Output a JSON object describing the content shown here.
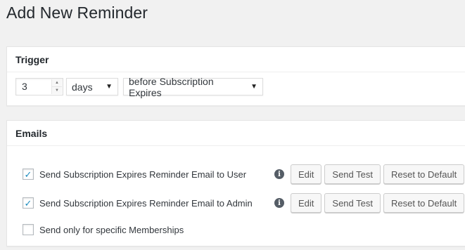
{
  "page": {
    "title": "Add New Reminder"
  },
  "trigger": {
    "heading": "Trigger",
    "amount": "3",
    "unit_select": "days",
    "when_select": "before Subscription Expires"
  },
  "emails": {
    "heading": "Emails",
    "rows": [
      {
        "label": "Send Subscription Expires Reminder Email to User",
        "checked": true,
        "check_glyph": "✓"
      },
      {
        "label": "Send Subscription Expires Reminder Email to Admin",
        "checked": true,
        "check_glyph": "✓"
      },
      {
        "label": "Send only for specific Memberships",
        "checked": false,
        "check_glyph": ""
      }
    ],
    "buttons": {
      "edit": "Edit",
      "send_test": "Send Test",
      "reset": "Reset to Default"
    },
    "info_glyph": "i"
  },
  "colors": {
    "accent": "#1e8cbe",
    "background": "#f1f1f1"
  },
  "icons": {
    "info": "info-circle-icon",
    "check": "checkmark-icon",
    "caret": "caret-down-icon"
  }
}
